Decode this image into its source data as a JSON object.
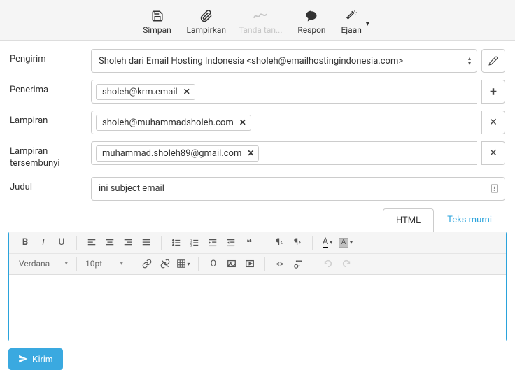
{
  "toolbar": {
    "save": "Simpan",
    "attach": "Lampirkan",
    "sign": "Tanda tan...",
    "respond": "Respon",
    "spell": "Ejaan"
  },
  "labels": {
    "sender": "Pengirim",
    "recipient": "Penerima",
    "cc": "Lampiran",
    "bcc": "Lampiran tersembunyi",
    "subject": "Judul"
  },
  "sender": {
    "display": "Sholeh dari Email Hosting Indonesia <sholeh@emailhostingindonesia.com>"
  },
  "recipients": {
    "to": [
      "sholeh@krm.email"
    ],
    "cc": [
      "sholeh@muhammadsholeh.com"
    ],
    "bcc": [
      "muhammad.sholeh89@gmail.com"
    ]
  },
  "subject": "ini subject email",
  "tabs": {
    "html": "HTML",
    "plain": "Teks murni"
  },
  "editor": {
    "font": "Verdana",
    "size": "10pt"
  },
  "send": "Kirim"
}
